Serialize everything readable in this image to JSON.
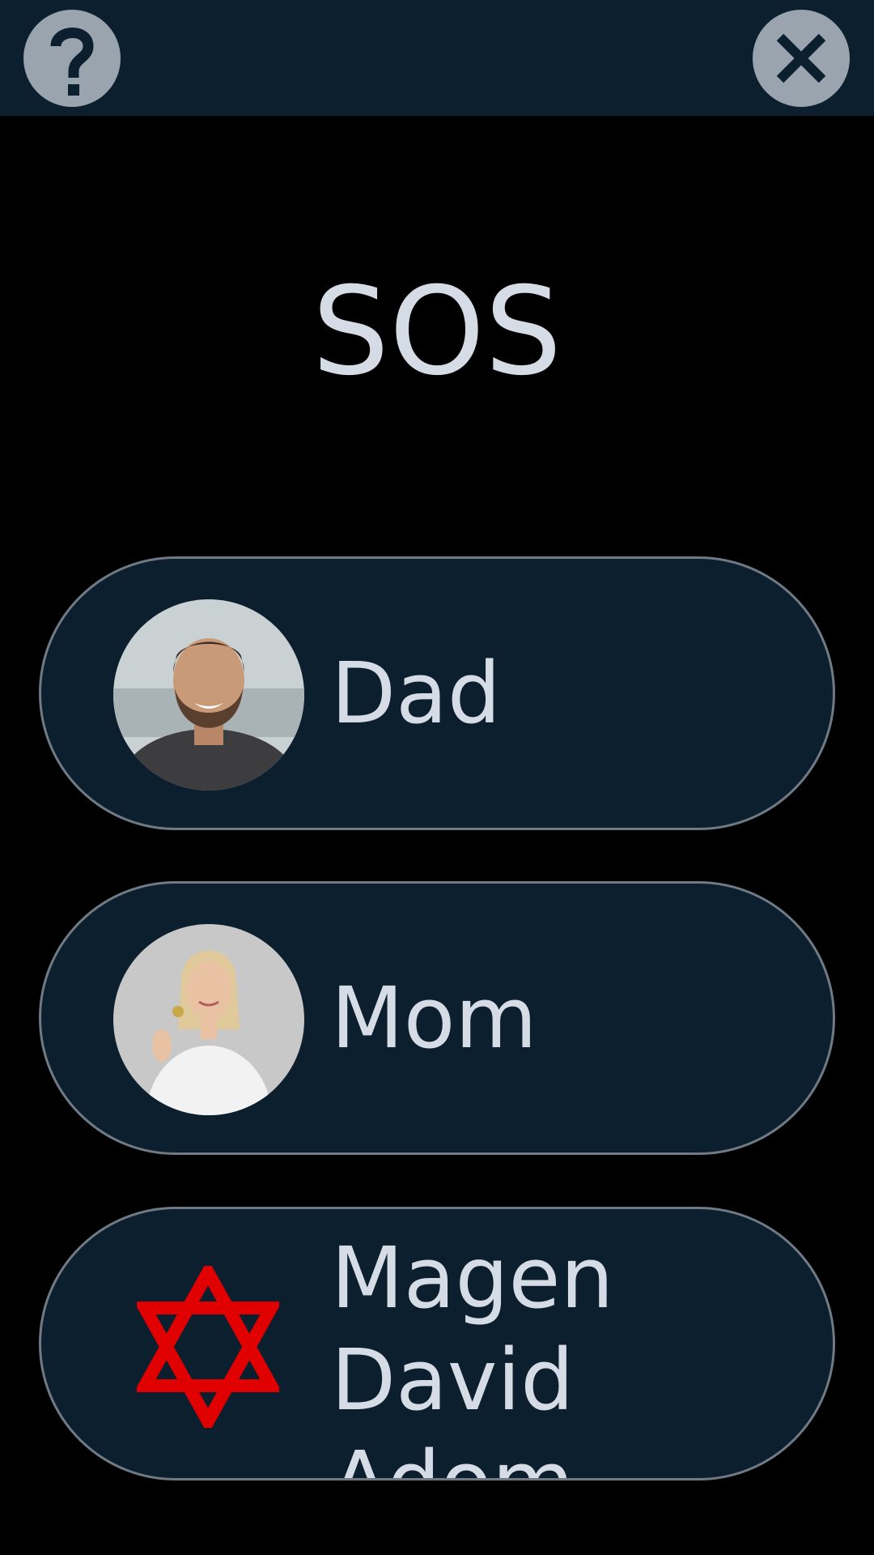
{
  "header": {
    "help_icon": "question-mark-icon",
    "close_icon": "close-x-icon",
    "background_color": "#0c1f2e",
    "button_color": "#9aa4ae"
  },
  "screen": {
    "title": "SOS"
  },
  "contacts": [
    {
      "label": "Dad",
      "avatar": "man-with-beard-photo"
    },
    {
      "label": "Mom",
      "avatar": "blonde-woman-photo"
    },
    {
      "label": "Magen David Adom",
      "icon": "star-of-david-icon",
      "icon_color": "#e00000"
    }
  ],
  "colors": {
    "page_background": "#000000",
    "card_background": "#0c1f2e",
    "card_border": "#6f7a84",
    "text": "#d6dce5"
  }
}
